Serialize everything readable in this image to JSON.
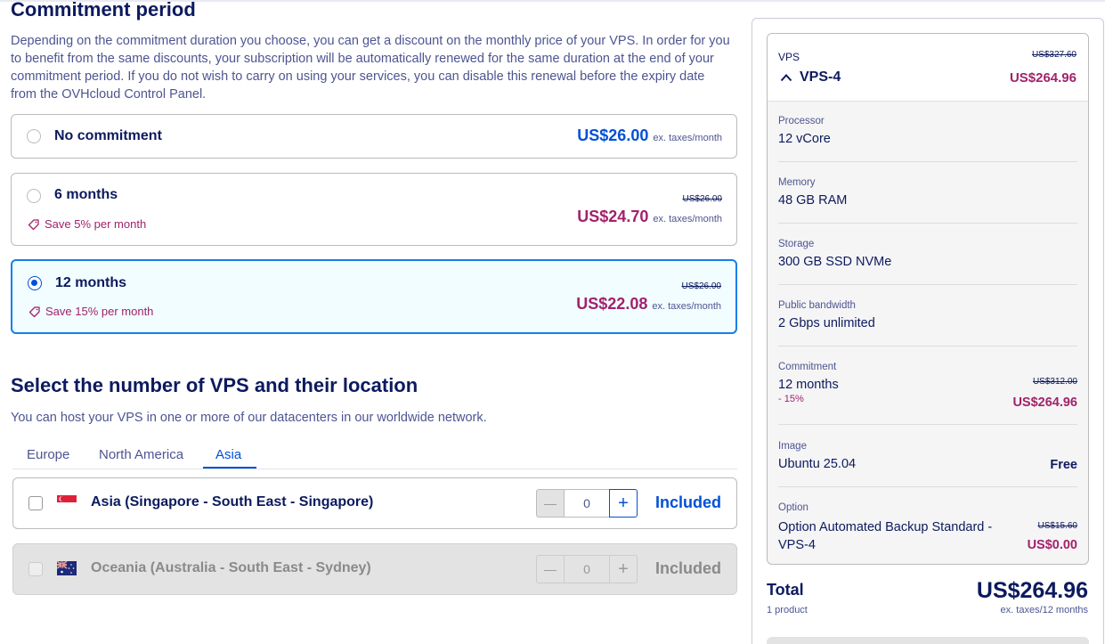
{
  "commitment": {
    "title": "Commitment period",
    "description": "Depending on the commitment duration you choose, you can get a discount on the monthly price of your VPS. In order for you to benefit from the same discounts, your subscription will be automatically renewed for the same duration at the end of your commitment period. If you do not wish to carry on using your services, you can disable this renewal before the expiry date from the OVHcloud Control Panel.",
    "options": [
      {
        "label": "No commitment",
        "price": "US$26.00",
        "unit": "ex. taxes/month",
        "strike": "",
        "save": "",
        "selected": false
      },
      {
        "label": "6 months",
        "price": "US$24.70",
        "unit": "ex. taxes/month",
        "strike": "US$26.00",
        "save": "Save 5% per month",
        "selected": false
      },
      {
        "label": "12 months",
        "price": "US$22.08",
        "unit": "ex. taxes/month",
        "strike": "US$26.00",
        "save": "Save 15% per month",
        "selected": true
      }
    ]
  },
  "location": {
    "title": "Select the number of VPS and their location",
    "subtitle": "You can host your VPS in one or more of our datacenters in our worldwide network.",
    "tabs": [
      "Europe",
      "North America",
      "Asia"
    ],
    "active_tab": "Asia",
    "items": [
      {
        "label": "Asia (Singapore - South East - Singapore)",
        "quantity": "0",
        "status": "Included",
        "flag": "singapore-flag-icon",
        "disabled": false
      },
      {
        "label": "Oceania (Australia - South East - Sydney)",
        "quantity": "0",
        "status": "Included",
        "flag": "australia-flag-icon",
        "disabled": true
      }
    ],
    "minus": "—",
    "plus": "+"
  },
  "summary": {
    "product_type": "VPS",
    "product_name": "VPS-4",
    "strike_price": "US$327.60",
    "price": "US$264.96",
    "rows": {
      "processor": {
        "label": "Processor",
        "value": "12 vCore"
      },
      "memory": {
        "label": "Memory",
        "value": "48 GB RAM"
      },
      "storage": {
        "label": "Storage",
        "value": "300 GB SSD NVMe"
      },
      "bandwidth": {
        "label": "Public bandwidth",
        "value": "2 Gbps unlimited"
      },
      "commitment": {
        "label": "Commitment",
        "value": "12 months",
        "discount": "- 15%",
        "strike": "US$312.00",
        "price": "US$264.96"
      },
      "image": {
        "label": "Image",
        "value": "Ubuntu 25.04",
        "price": "Free"
      },
      "option": {
        "label": "Option",
        "value_line1": "Option Automated Backup Standard -",
        "value_line2": "VPS-4",
        "strike": "US$15.60",
        "price": "US$0.00"
      }
    },
    "total_label": "Total",
    "total_sub": "1 product",
    "total_value": "US$264.96",
    "total_unit": "ex. taxes/12 months"
  },
  "colors": {
    "accent": "#0050d7",
    "discount": "#a2226b",
    "heading": "#0c1a5e"
  }
}
